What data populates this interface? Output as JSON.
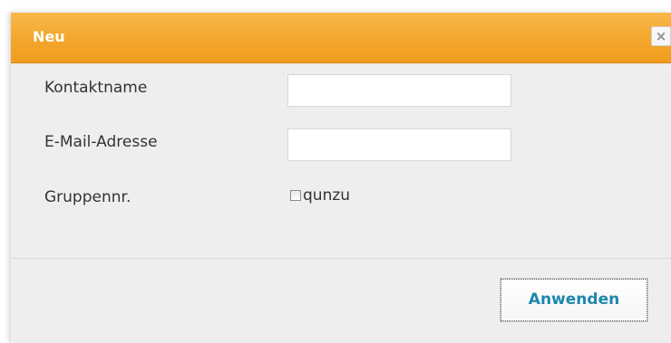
{
  "dialog": {
    "title": "Neu",
    "close_label": "×",
    "accent_color": "#f3a62b"
  },
  "form": {
    "contact_name": {
      "label": "Kontaktname",
      "value": ""
    },
    "email": {
      "label": "E-Mail-Adresse",
      "value": ""
    },
    "group": {
      "label": "Gruppennr.",
      "checkbox_label": "qunzu",
      "checked": false
    }
  },
  "footer": {
    "apply_label": "Anwenden",
    "apply_color": "#1d87ad"
  }
}
